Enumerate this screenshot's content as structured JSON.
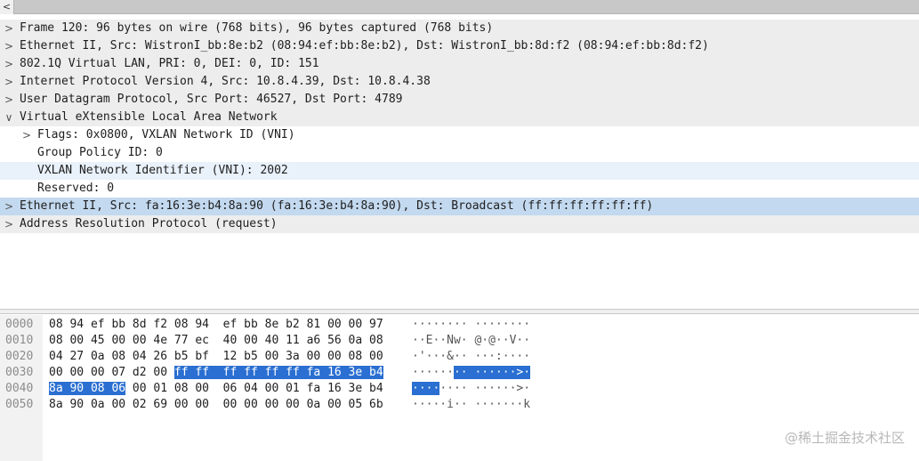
{
  "scroll_arrow": "<",
  "tree": [
    {
      "twisty": ">",
      "text": "Frame 120: 96 bytes on wire (768 bits), 96 bytes captured (768 bits)"
    },
    {
      "twisty": ">",
      "text": "Ethernet II, Src: WistronI_bb:8e:b2 (08:94:ef:bb:8e:b2), Dst: WistronI_bb:8d:f2 (08:94:ef:bb:8d:f2)"
    },
    {
      "twisty": ">",
      "text": "802.1Q Virtual LAN, PRI: 0, DEI: 0, ID: 151"
    },
    {
      "twisty": ">",
      "text": "Internet Protocol Version 4, Src: 10.8.4.39, Dst: 10.8.4.38"
    },
    {
      "twisty": ">",
      "text": "User Datagram Protocol, Src Port: 46527, Dst Port: 4789"
    },
    {
      "twisty": "∨",
      "text": "Virtual eXtensible Local Area Network"
    },
    {
      "twisty": ">",
      "text": "Flags: 0x0800, VXLAN Network ID (VNI)"
    },
    {
      "twisty": "",
      "text": "Group Policy ID: 0"
    },
    {
      "twisty": "",
      "text": "VXLAN Network Identifier (VNI): 2002"
    },
    {
      "twisty": "",
      "text": "Reserved: 0"
    },
    {
      "twisty": ">",
      "text": "Ethernet II, Src: fa:16:3e:b4:8a:90 (fa:16:3e:b4:8a:90), Dst: Broadcast (ff:ff:ff:ff:ff:ff)"
    },
    {
      "twisty": ">",
      "text": "Address Resolution Protocol (request)"
    }
  ],
  "hex_rows": [
    {
      "offset": "0000",
      "bytes_plain": "08 94 ef bb 8d f2 08 94  ef bb 8e b2 81 00 00 97",
      "bytes_sel": "",
      "bytes_after": "",
      "ascii_plain": "········ ········",
      "ascii_sel": "",
      "ascii_after": ""
    },
    {
      "offset": "0010",
      "bytes_plain": "08 00 45 00 00 4e 77 ec  40 00 40 11 a6 56 0a 08",
      "bytes_sel": "",
      "bytes_after": "",
      "ascii_plain": "··E··Nw· @·@··V··",
      "ascii_sel": "",
      "ascii_after": ""
    },
    {
      "offset": "0020",
      "bytes_plain": "04 27 0a 08 04 26 b5 bf  12 b5 00 3a 00 00 08 00",
      "bytes_sel": "",
      "bytes_after": "",
      "ascii_plain": "·'···&·· ···:····",
      "ascii_sel": "",
      "ascii_after": ""
    },
    {
      "offset": "0030",
      "bytes_plain": "00 00 00 07 d2 00 ",
      "bytes_sel": "ff ff  ff ff ff ff fa 16 3e b4",
      "bytes_after": "",
      "ascii_plain": "······",
      "ascii_sel": "·· ······>·",
      "ascii_after": ""
    },
    {
      "offset": "0040",
      "bytes_plain": "",
      "bytes_sel": "8a 90 08 06",
      "bytes_after": " 00 01 08 00  06 04 00 01 fa 16 3e b4",
      "ascii_plain": "",
      "ascii_sel": "····",
      "ascii_after": "···· ······>·"
    },
    {
      "offset": "0050",
      "bytes_plain": "8a 90 0a 00 02 69 00 00  00 00 00 00 0a 00 05 6b",
      "bytes_sel": "",
      "bytes_after": "",
      "ascii_plain": "·····i·· ·······k",
      "ascii_sel": "",
      "ascii_after": ""
    }
  ],
  "watermark": "@稀土掘金技术社区"
}
